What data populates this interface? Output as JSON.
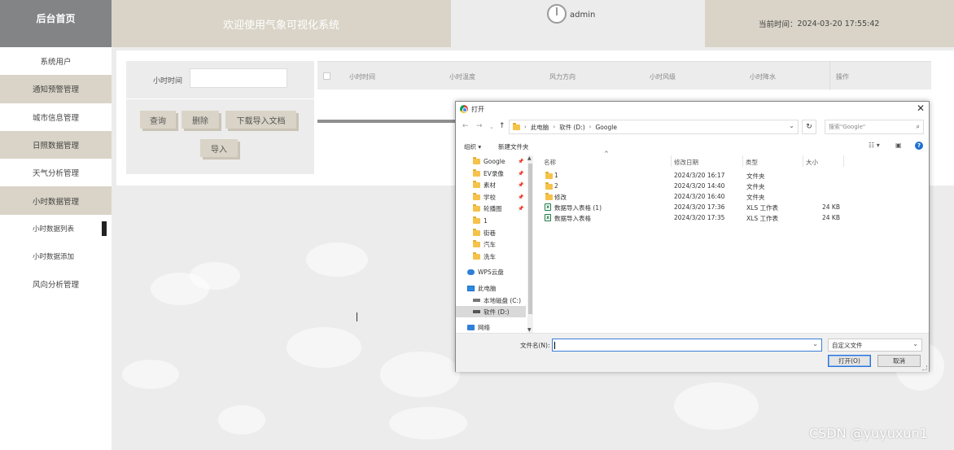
{
  "header": {
    "logo": "后台首页",
    "title": "欢迎使用气象可视化系统",
    "username": "admin",
    "time_label": "当前时间：",
    "time_value": "2024-03-20 17:55:42"
  },
  "sidebar": {
    "items": [
      {
        "label": "系统用户"
      },
      {
        "label": "通知预警管理"
      },
      {
        "label": "城市信息管理"
      },
      {
        "label": "日照数据管理"
      },
      {
        "label": "天气分析管理"
      },
      {
        "label": "小时数据管理"
      },
      {
        "label": "小时数据列表"
      },
      {
        "label": "小时数据添加"
      },
      {
        "label": "风向分析管理"
      }
    ]
  },
  "search": {
    "label": "小时时间",
    "value": "",
    "buttons": {
      "query": "查询",
      "delete": "删除",
      "download": "下载导入文档",
      "import": "导入"
    }
  },
  "table": {
    "columns": [
      "小时时间",
      "小时温度",
      "风力方向",
      "小时风级",
      "小时降水",
      "操作"
    ]
  },
  "dialog": {
    "title": "打开",
    "path": [
      "此电脑",
      "软件 (D:)",
      "Google"
    ],
    "search_placeholder": "搜索\"Google\"",
    "toolbar": {
      "organize": "组织 ▾",
      "new_folder": "新建文件夹"
    },
    "tree": [
      {
        "label": "Google",
        "pinned": true
      },
      {
        "label": "EV录像",
        "pinned": true
      },
      {
        "label": "素材",
        "pinned": true
      },
      {
        "label": "学校",
        "pinned": true
      },
      {
        "label": "轮播图",
        "pinned": true
      },
      {
        "label": "1",
        "pinned": false
      },
      {
        "label": "街巷",
        "pinned": false
      },
      {
        "label": "汽车",
        "pinned": false
      },
      {
        "label": "洗车",
        "pinned": false
      },
      {
        "label": "WPS云盘"
      },
      {
        "label": "此电脑"
      },
      {
        "label": "本地磁盘 (C:)"
      },
      {
        "label": "软件 (D:)"
      },
      {
        "label": "网络"
      }
    ],
    "columns": [
      "名称",
      "修改日期",
      "类型",
      "大小"
    ],
    "files": [
      {
        "name": "1",
        "date": "2024/3/20 16:17",
        "type": "文件夹",
        "size": "",
        "kind": "folder"
      },
      {
        "name": "2",
        "date": "2024/3/20 14:40",
        "type": "文件夹",
        "size": "",
        "kind": "folder"
      },
      {
        "name": "修改",
        "date": "2024/3/20 16:40",
        "type": "文件夹",
        "size": "",
        "kind": "folder"
      },
      {
        "name": "数据导入表格 (1)",
        "date": "2024/3/20 17:36",
        "type": "XLS 工作表",
        "size": "24 KB",
        "kind": "xls"
      },
      {
        "name": "数据导入表格",
        "date": "2024/3/20 17:35",
        "type": "XLS 工作表",
        "size": "24 KB",
        "kind": "xls"
      }
    ],
    "filename_label": "文件名(N):",
    "filename_value": "",
    "filetype": "自定义文件",
    "open_btn": "打开(O)",
    "cancel_btn": "取消"
  },
  "watermark": "CSDN @yuyuxun1"
}
